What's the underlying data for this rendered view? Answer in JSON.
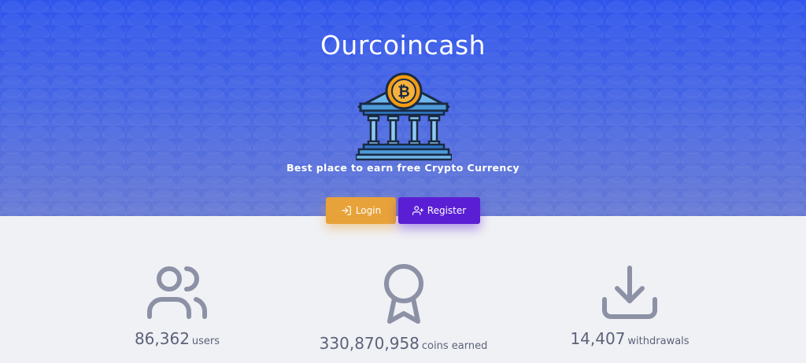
{
  "hero": {
    "title": "Ourcoincash",
    "tagline": "Best place to earn free Crypto Currency",
    "logo_icon": "bitcoin-bank-icon",
    "login_label": "Login",
    "register_label": "Register"
  },
  "stats": [
    {
      "value": "86,362",
      "label": "users",
      "icon": "users-icon"
    },
    {
      "value": "330,870,958",
      "label": "coins earned",
      "icon": "award-ribbon-icon"
    },
    {
      "value": "14,407",
      "label": "withdrawals",
      "icon": "download-icon"
    }
  ],
  "colors": {
    "hero_top": "#2f54ec",
    "hero_bottom": "#6679d4",
    "login_button": "#e8a23a",
    "register_button": "#5a1fd4",
    "background": "#f0f1f4",
    "stat_text": "#5c627a"
  }
}
